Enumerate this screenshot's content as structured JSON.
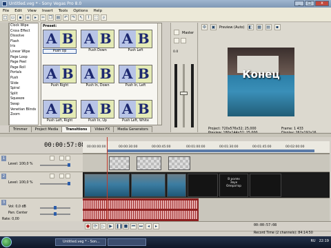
{
  "window": {
    "title": "Untitled.veg * - Sony Vegas Pro 8.0",
    "min": "_",
    "max": "□",
    "close": "x"
  },
  "menu": [
    "File",
    "Edit",
    "View",
    "Insert",
    "Tools",
    "Options",
    "Help"
  ],
  "toolbar": {
    "icons": [
      "new-icon",
      "open-icon",
      "save-icon",
      "properties-icon",
      "render-icon",
      "cut-icon",
      "copy-icon",
      "paste-icon",
      "undo-icon",
      "redo-icon",
      "edit-tool-icon",
      "envelope-tool-icon",
      "selection-tool-icon",
      "zoom-tool-icon"
    ]
  },
  "transitions": {
    "list": [
      "Clock Wipe",
      "Cross Effect",
      "Dissolve",
      "Flash",
      "Iris",
      "Linear Wipe",
      "Page Loop",
      "Page Peel",
      "Page Roll",
      "Portals",
      "Push",
      "Slide",
      "Spiral",
      "Split",
      "Squeeze",
      "Swap",
      "Venetian Blinds",
      "Zoom"
    ],
    "preset_label": "Preset:",
    "presets": [
      "Push Up",
      "Push Down",
      "Push Left",
      "Push Right",
      "Push In, Down",
      "Push In, Left",
      "Push Left, Right",
      "Push In, Up",
      "Push Left, White"
    ],
    "thumb_left": "A",
    "thumb_right": "B"
  },
  "tabs": [
    "Trimmer",
    "Project Media",
    "Transitions",
    "Video FX",
    "Media Generators"
  ],
  "master": {
    "title": "Master",
    "db": "0.0"
  },
  "preview": {
    "mode": "Preview (Auto)",
    "overlay_word": "Конец",
    "project": "Project:   720x576x32; 25,000",
    "preview_line": "Preview:   180x144x32; 25,000",
    "frame": "Frame:       1 433",
    "display": "Display:   262x192x16"
  },
  "timeline": {
    "time": "00:00:57:08",
    "ruler": [
      "00:00:00:00",
      "00:00:30:00",
      "00:00:45:00",
      "00:01:00:00",
      "00:01:30:00",
      "00:01:45:00",
      "00:02:00:00"
    ],
    "track1": {
      "num": "1",
      "level": "Level: 100,0 %"
    },
    "track2": {
      "num": "2",
      "level": "Level: 100,0 %"
    },
    "track3": {
      "num": "3",
      "vol": "Vol:     0,0 dB",
      "pan": "Pan:      Center",
      "rate": "Rate: 0,00"
    },
    "clip_text": "В ролях\nЗвук\nОператор",
    "transport_time": "00:00:57:08",
    "record_time": "Record Time (2 channels): 84:14:50"
  },
  "taskbar": {
    "item1": "Untitled.veg * - Son...",
    "item2": "",
    "lang": "RU",
    "clock": "22:19"
  }
}
